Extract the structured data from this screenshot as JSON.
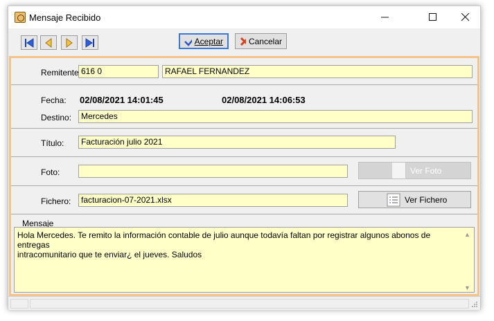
{
  "window": {
    "title": "Mensaje Recibido"
  },
  "toolbar": {
    "accept_label": "Aceptar",
    "cancel_label": "Cancelar"
  },
  "form": {
    "remitente_label": "Remitente:",
    "remitente_code": "616     0",
    "remitente_name": "RAFAEL FERNANDEZ",
    "fecha_label": "Fecha:",
    "fecha_1": "02/08/2021 14:01:45",
    "fecha_2": "02/08/2021 14:06:53",
    "destino_label": "Destino:",
    "destino_value": "Mercedes",
    "titulo_label": "Título:",
    "titulo_value": "Facturación julio 2021",
    "foto_label": "Foto:",
    "foto_value": "",
    "ver_foto_label": "Ver Foto",
    "fichero_label": "Fichero:",
    "fichero_value": "facturacion-07-2021.xlsx",
    "ver_fichero_label": "Ver Fichero"
  },
  "mensaje": {
    "legend": "Mensaje",
    "line1": "Hola Mercedes. Te remito la información contable de julio aunque todavía faltan por registrar algunos abonos de entregas",
    "line2": "intracomunitario que te enviar¿ el jueves. Saludos"
  },
  "colors": {
    "field_bg": "#ffffc8",
    "frame_border": "#f2c38a",
    "focus_border": "#3a78d8"
  }
}
